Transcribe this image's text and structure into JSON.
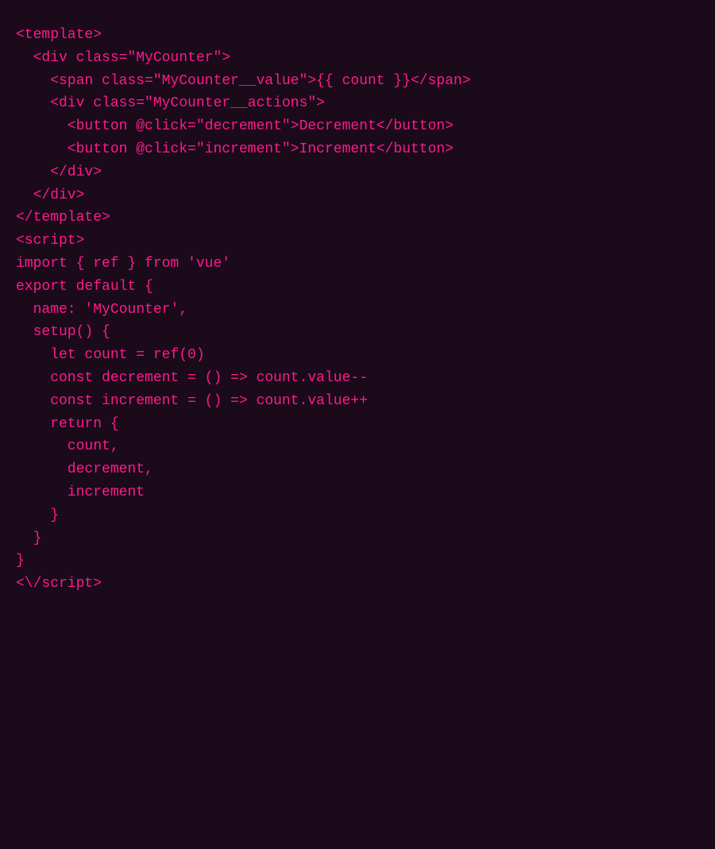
{
  "code": {
    "lines": [
      "<template>",
      "  <div class=\"MyCounter\">",
      "    <span class=\"MyCounter__value\">{{ count }}</span>",
      "    <div class=\"MyCounter__actions\">",
      "      <button @click=\"decrement\">Decrement</button>",
      "      <button @click=\"increment\">Increment</button>",
      "    </div>",
      "  </div>",
      "</template>",
      "",
      "<script>",
      "import { ref } from 'vue'",
      "",
      "export default {",
      "  name: 'MyCounter',",
      "  setup() {",
      "    let count = ref(0)",
      "",
      "    const decrement = () => count.value--",
      "    const increment = () => count.value++",
      "",
      "    return {",
      "      count,",
      "      decrement,",
      "      increment",
      "    }",
      "  }",
      "}",
      "<\\/script>"
    ]
  }
}
